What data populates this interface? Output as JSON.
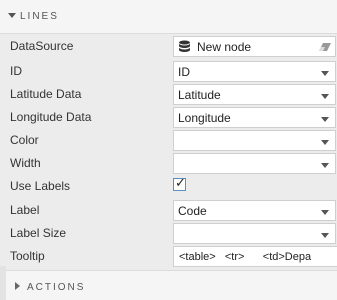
{
  "section": {
    "title": "LINES"
  },
  "fields": {
    "datasource": {
      "label": "DataSource",
      "value": "New node"
    },
    "id": {
      "label": "ID",
      "value": "ID"
    },
    "latitude": {
      "label": "Latitude Data",
      "value": "Latitude"
    },
    "longitude": {
      "label": "Longitude Data",
      "value": "Longitude"
    },
    "color": {
      "label": "Color",
      "value": ""
    },
    "width": {
      "label": "Width",
      "value": ""
    },
    "use_labels": {
      "label": "Use Labels",
      "checked": true,
      "mark": "✓"
    },
    "label": {
      "label": "Label",
      "value": "Code"
    },
    "label_size": {
      "label": "Label Size",
      "value": ""
    },
    "tooltip": {
      "label": "Tooltip",
      "value": "<table>   <tr>      <td>Depa"
    }
  },
  "actions": {
    "title": "ACTIONS"
  },
  "colors": {
    "checkbox_border": "#5a8fbf",
    "panel_bg": "#ececec"
  }
}
